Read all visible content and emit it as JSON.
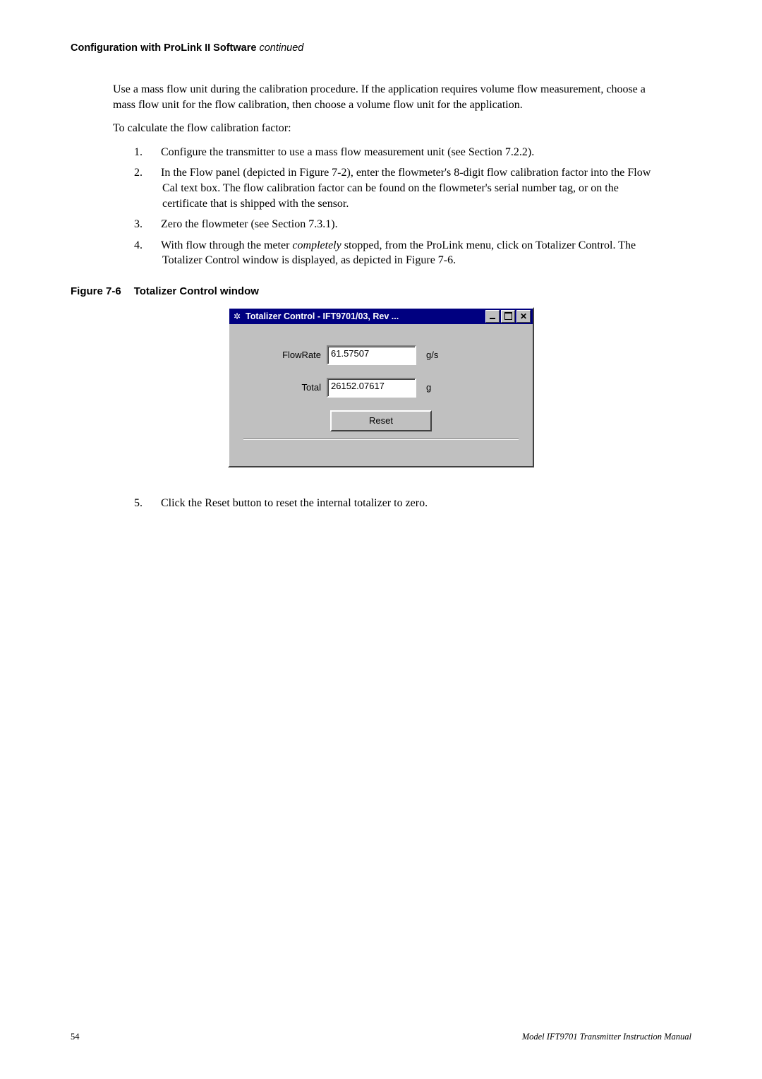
{
  "header": {
    "title": "Configuration with ProLink II Software",
    "continued": "continued"
  },
  "para1": "Use a mass flow unit during the calibration procedure. If the application requires volume flow measurement, choose a mass flow unit for the flow calibration, then choose a volume flow unit for the application.",
  "para2": "To calculate the flow calibration factor:",
  "steps14": [
    "Configure the transmitter to use a mass flow measurement unit (see Section 7.2.2).",
    "In the Flow panel (depicted in Figure 7-2), enter the flowmeter's 8-digit flow calibration factor into the Flow Cal text box. The flow calibration factor can be found on the flowmeter's serial number tag, or on the certificate that is shipped with the sensor.",
    "Zero the flowmeter (see Section 7.3.1).",
    "With flow through the meter completely stopped, from the ProLink menu, click on Totalizer Control. The Totalizer Control window is displayed, as depicted in Figure 7-6."
  ],
  "figure": {
    "number": "Figure 7-6",
    "title": "Totalizer Control window"
  },
  "window": {
    "title": "Totalizer Control - IFT9701/03, Rev ...",
    "flowrate_label": "FlowRate",
    "flowrate_value": "61.57507",
    "flowrate_unit": "g/s",
    "total_label": "Total",
    "total_value": "26152.07617",
    "total_unit": "g",
    "reset_label": "Reset"
  },
  "step5": "Click the Reset button to reset the internal totalizer to zero.",
  "footer": {
    "page": "54",
    "doc": "Model IFT9701 Transmitter Instruction Manual"
  }
}
